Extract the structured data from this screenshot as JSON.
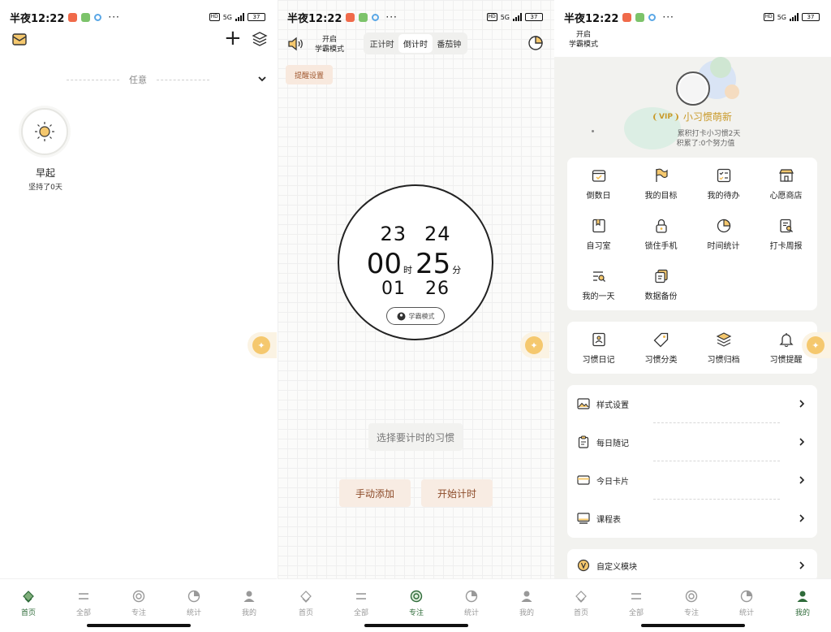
{
  "status": {
    "time": "半夜12:22",
    "battery": "37",
    "network": "5G",
    "hd": "HD",
    "more": "···"
  },
  "colors": {
    "accent": "#2f6b3a",
    "gold": "#c99a2a",
    "button_text": "#8c4a28"
  },
  "tabs": [
    "首页",
    "全部",
    "专注",
    "统计",
    "我的"
  ],
  "home": {
    "filter_label": "任意",
    "habit": {
      "name": "早起",
      "streak": "坚持了0天"
    }
  },
  "focus": {
    "mode_label_1": "开启",
    "mode_label_2": "学霸模式",
    "segments": [
      "正计时",
      "倒计时",
      "番茄钟"
    ],
    "selected_segment": "倒计时",
    "remind_settings": "提醒设置",
    "picker": {
      "upper": [
        "23",
        "24"
      ],
      "hour": "00",
      "hour_unit": "时",
      "minute": "25",
      "minute_unit": "分",
      "lower": [
        "01",
        "26"
      ]
    },
    "pill_label": "学霸模式",
    "choose_habit": "选择要计时的习惯",
    "manual_add": "手动添加",
    "start_timer": "开始计时"
  },
  "profile": {
    "mode_label_1": "开启",
    "mode_label_2": "学霸模式",
    "vip": "VIP",
    "username": "小习惯萌新",
    "checkin_days": "累积打卡小习惯2天",
    "effort": "积累了:0个努力值",
    "tools": [
      "倒数日",
      "我的目标",
      "我的待办",
      "心愿商店",
      "自习室",
      "锁住手机",
      "时间统计",
      "打卡周报",
      "我的一天",
      "数据备份"
    ],
    "habit_tools": [
      "习惯日记",
      "习惯分类",
      "习惯归档",
      "习惯提醒"
    ],
    "settings": [
      "样式设置",
      "每日随记",
      "今日卡片",
      "课程表"
    ],
    "custom_module": "自定义模块"
  }
}
